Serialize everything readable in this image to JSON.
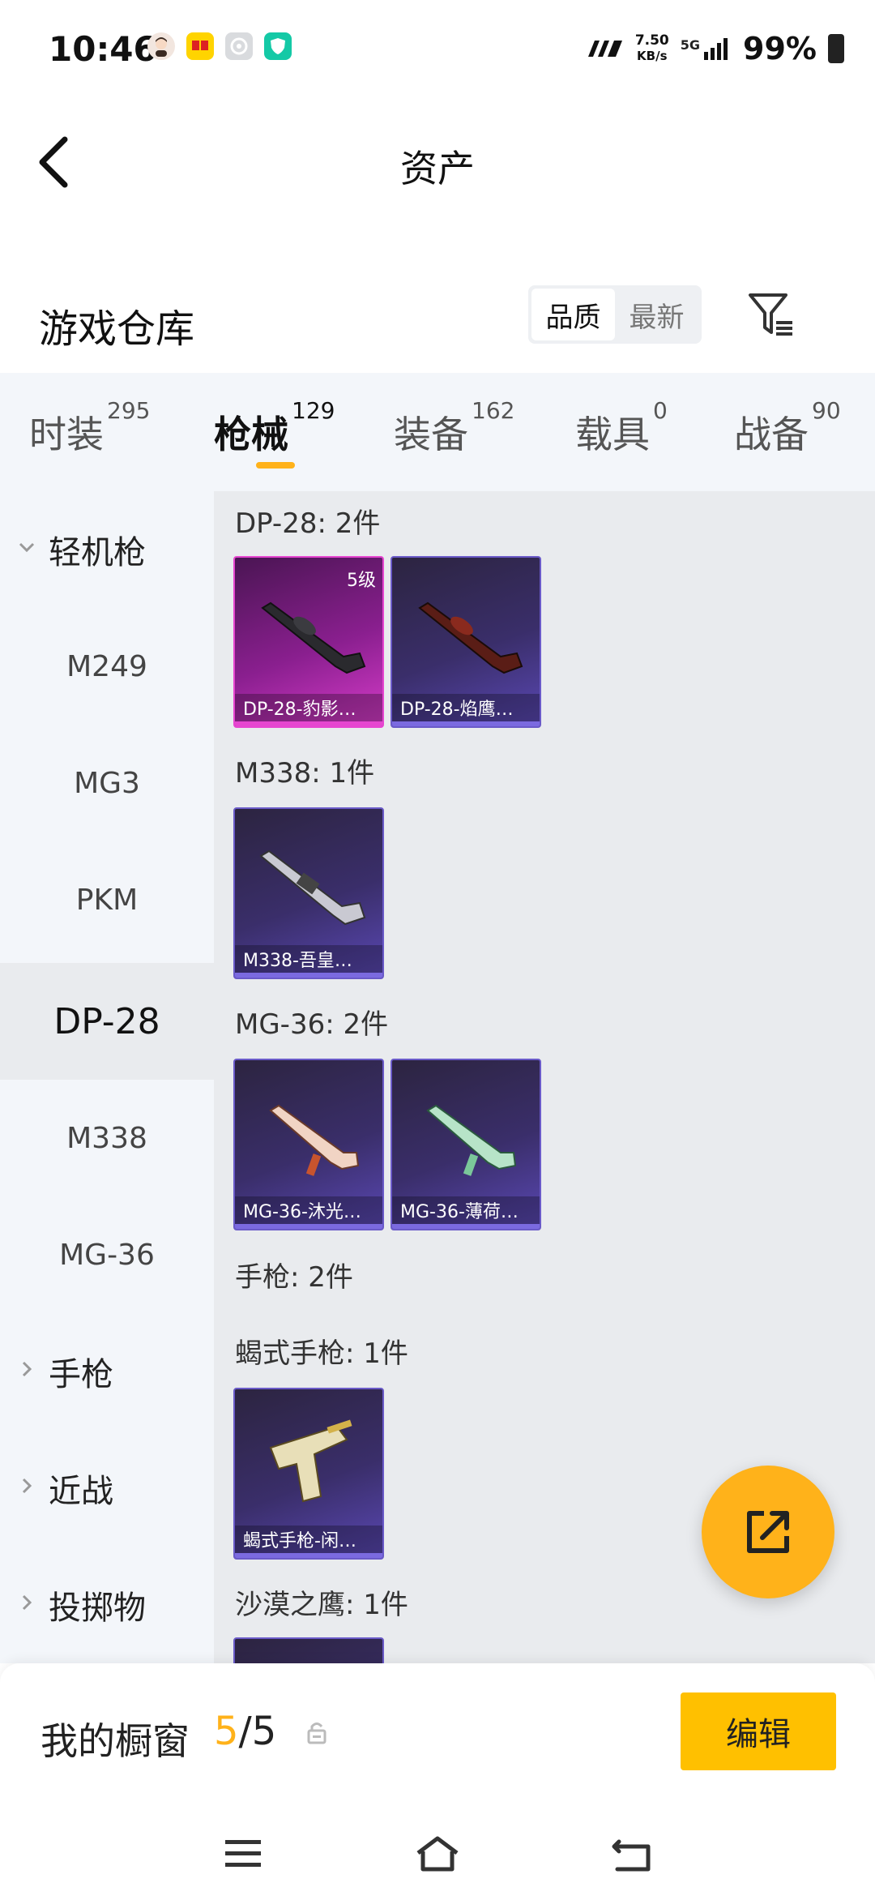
{
  "status_bar": {
    "time": "10:46",
    "net_speed_value": "7.50",
    "net_speed_unit": "KB/s",
    "network": "5G",
    "battery": "99%",
    "notification_icons": [
      "avatar-icon",
      "app-yellow-icon",
      "settings-app-icon",
      "shield-app-icon"
    ]
  },
  "header": {
    "title": "资产"
  },
  "warehouse": {
    "title": "游戏仓库",
    "sort_options": [
      "品质",
      "最新"
    ],
    "sort_selected": "品质"
  },
  "tabs": [
    {
      "label": "时装",
      "count": "295"
    },
    {
      "label": "枪械",
      "count": "129",
      "active": true
    },
    {
      "label": "装备",
      "count": "162"
    },
    {
      "label": "载具",
      "count": "0"
    },
    {
      "label": "战备",
      "count": "90"
    }
  ],
  "sidebar": {
    "items": [
      {
        "label": "轻机枪",
        "type": "group",
        "expanded": true
      },
      {
        "label": "M249"
      },
      {
        "label": "MG3"
      },
      {
        "label": "PKM"
      },
      {
        "label": "DP-28",
        "selected": true
      },
      {
        "label": "M338"
      },
      {
        "label": "MG-36"
      },
      {
        "label": "手枪",
        "type": "group"
      },
      {
        "label": "近战",
        "type": "group"
      },
      {
        "label": "投掷物",
        "type": "group"
      }
    ]
  },
  "content": {
    "sections": [
      {
        "label": "DP-28: 2件"
      },
      {
        "label": "M338: 1件"
      },
      {
        "label": "MG-36: 2件"
      },
      {
        "label": "手枪: 2件"
      },
      {
        "label": "蝎式手枪: 1件"
      },
      {
        "label": "沙漠之鹰: 1件"
      }
    ],
    "cards": [
      {
        "name": "DP-28-豹影…",
        "grade": "5级",
        "rarity": "pink"
      },
      {
        "name": "DP-28-焰鹰…",
        "rarity": "purple"
      },
      {
        "name": "M338-吾皇…",
        "rarity": "purple"
      },
      {
        "name": "MG-36-沐光…",
        "rarity": "purple"
      },
      {
        "name": "MG-36-薄荷…",
        "rarity": "purple"
      },
      {
        "name": "蝎式手枪-闲…",
        "rarity": "purple"
      }
    ]
  },
  "showcase": {
    "label": "我的橱窗",
    "current": "5",
    "separator": "/",
    "total": "5",
    "edit_label": "编辑"
  },
  "colors": {
    "accent": "#ffb21a",
    "edit_button": "#ffc000",
    "rarity_pink": "#e646d0",
    "rarity_purple": "#7b6ae0"
  }
}
